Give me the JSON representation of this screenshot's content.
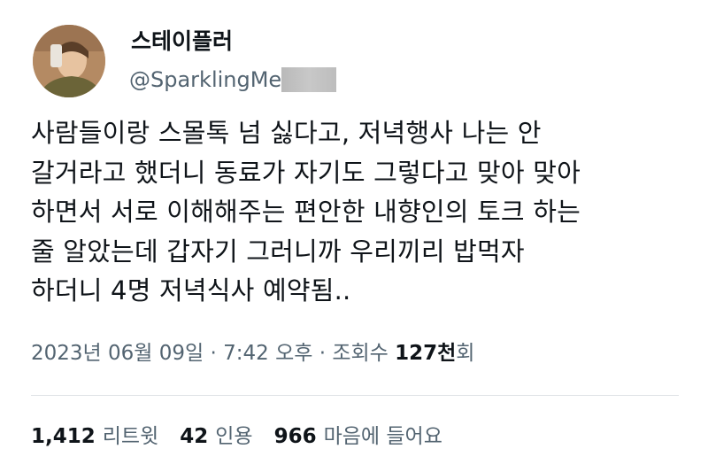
{
  "author": {
    "display_name": "스테이플러",
    "handle": "@SparklingMe"
  },
  "tweet": {
    "lines": [
      "사람들이랑 스몰톡 넘 싫다고, 저녁행사 나는 안",
      "갈거라고 했더니 동료가 자기도 그렇다고 맞아 맞아",
      "하면서 서로 이해해주는 편안한 내향인의 토크 하는",
      "줄 알았는데 갑자기 그러니까 우리끼리 밥먹자",
      "하더니 4명 저녁식사 예약됨.."
    ]
  },
  "meta": {
    "date": "2023년 06월 09일",
    "sep1": " · ",
    "time": "7:42 오후",
    "sep2": " · ",
    "views_label": "조회수 ",
    "views_count": "127천",
    "views_suffix": "회"
  },
  "stats": {
    "retweets_count": "1,412",
    "retweets_label": "리트윗",
    "quotes_count": "42",
    "quotes_label": "인용",
    "likes_count": "966",
    "likes_label": "마음에 들어요"
  }
}
